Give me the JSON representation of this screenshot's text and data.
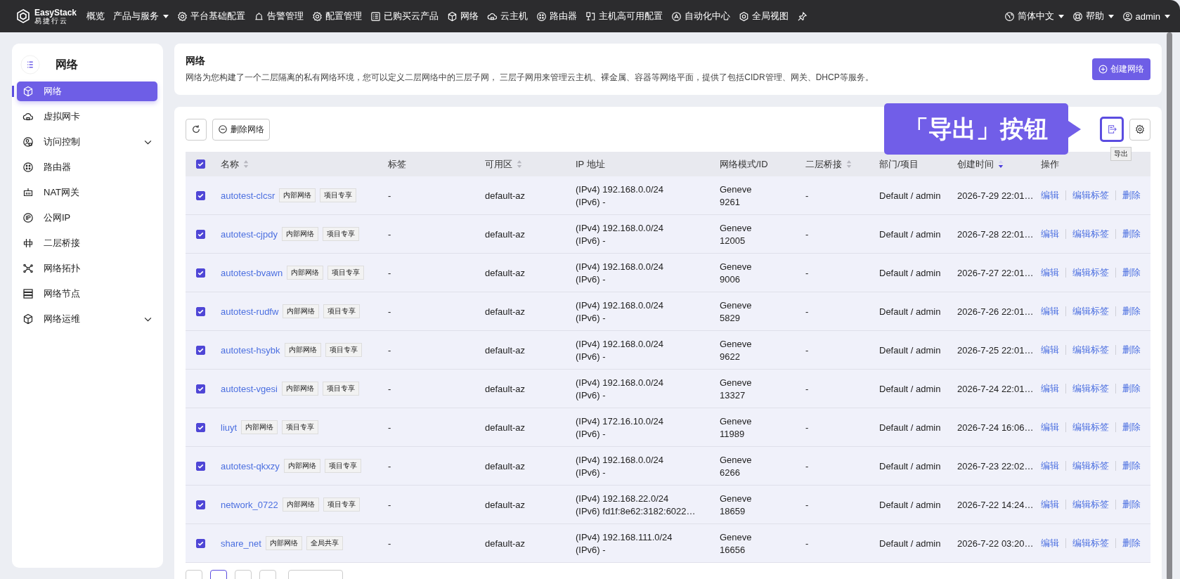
{
  "topnav": {
    "logo": {
      "name": "EasyStack",
      "sub": "易捷行云"
    },
    "items": [
      {
        "label": "概览",
        "dropdown": false
      },
      {
        "label": "产品与服务",
        "dropdown": true
      },
      {
        "label": "平台基础配置",
        "dropdown": false
      },
      {
        "label": "告警管理",
        "dropdown": false
      },
      {
        "label": "配置管理",
        "dropdown": false
      },
      {
        "label": "已购买云产品",
        "dropdown": false
      },
      {
        "label": "网络",
        "dropdown": false
      },
      {
        "label": "云主机",
        "dropdown": false
      },
      {
        "label": "路由器",
        "dropdown": false
      },
      {
        "label": "主机高可用配置",
        "dropdown": false
      },
      {
        "label": "自动化中心",
        "dropdown": false
      },
      {
        "label": "全局视图",
        "dropdown": false
      }
    ],
    "right": [
      {
        "label": "简体中文",
        "dropdown": true
      },
      {
        "label": "帮助",
        "dropdown": true
      },
      {
        "label": "admin",
        "dropdown": true
      }
    ]
  },
  "sidebar": {
    "title": "网络",
    "items": [
      {
        "label": "网络",
        "selected": true,
        "expandable": false
      },
      {
        "label": "虚拟网卡",
        "selected": false,
        "expandable": false
      },
      {
        "label": "访问控制",
        "selected": false,
        "expandable": true
      },
      {
        "label": "路由器",
        "selected": false,
        "expandable": false
      },
      {
        "label": "NAT网关",
        "selected": false,
        "expandable": false
      },
      {
        "label": "公网IP",
        "selected": false,
        "expandable": false
      },
      {
        "label": "二层桥接",
        "selected": false,
        "expandable": false
      },
      {
        "label": "网络拓扑",
        "selected": false,
        "expandable": false
      },
      {
        "label": "网络节点",
        "selected": false,
        "expandable": false
      },
      {
        "label": "网络运维",
        "selected": false,
        "expandable": true
      }
    ]
  },
  "header": {
    "title": "网络",
    "description": "网络为您构建了一个二层隔离的私有网络环境，您可以定义二层网络中的三层子网， 三层子网用来管理云主机、裸金属、容器等网络平面，提供了包括CIDR管理、网关、DHCP等服务。",
    "create_button": "创建网络"
  },
  "toolbar": {
    "delete_button": "删除网络",
    "callout": "「导出」按钮",
    "export_highlighted": true,
    "export_tooltip": "导出"
  },
  "table": {
    "all_checked": true,
    "columns": [
      {
        "label": "名称",
        "sortable": true
      },
      {
        "label": "标签",
        "sortable": false
      },
      {
        "label": "可用区",
        "sortable": true
      },
      {
        "label": "IP 地址",
        "sortable": false
      },
      {
        "label": "网络模式/ID",
        "sortable": false
      },
      {
        "label": "二层桥接",
        "sortable": true
      },
      {
        "label": "部门/项目",
        "sortable": false
      },
      {
        "label": "创建时间",
        "sortable": true,
        "sorted": true
      },
      {
        "label": "操作",
        "sortable": false
      }
    ],
    "rows": [
      {
        "checked": true,
        "name": "autotest-clcsr",
        "tags": [
          "内部网络",
          "项目专享"
        ],
        "labels": "-",
        "az": "default-az",
        "ipv4": "(IPv4) 192.168.0.0/24",
        "ipv6": "(IPv6) -",
        "mode": "Geneve",
        "mode_id": "9261",
        "bridge": "-",
        "project": "Default / admin",
        "created": "2026-7-29 22:01…",
        "actions": [
          "编辑",
          "编辑标签",
          "删除"
        ]
      },
      {
        "checked": true,
        "name": "autotest-cjpdy",
        "tags": [
          "内部网络",
          "项目专享"
        ],
        "labels": "-",
        "az": "default-az",
        "ipv4": "(IPv4) 192.168.0.0/24",
        "ipv6": "(IPv6) -",
        "mode": "Geneve",
        "mode_id": "12005",
        "bridge": "-",
        "project": "Default / admin",
        "created": "2026-7-28 22:01…",
        "actions": [
          "编辑",
          "编辑标签",
          "删除"
        ]
      },
      {
        "checked": true,
        "name": "autotest-bvawn",
        "tags": [
          "内部网络",
          "项目专享"
        ],
        "labels": "-",
        "az": "default-az",
        "ipv4": "(IPv4) 192.168.0.0/24",
        "ipv6": "(IPv6) -",
        "mode": "Geneve",
        "mode_id": "9006",
        "bridge": "-",
        "project": "Default / admin",
        "created": "2026-7-27 22:01…",
        "actions": [
          "编辑",
          "编辑标签",
          "删除"
        ]
      },
      {
        "checked": true,
        "name": "autotest-rudfw",
        "tags": [
          "内部网络",
          "项目专享"
        ],
        "labels": "-",
        "az": "default-az",
        "ipv4": "(IPv4) 192.168.0.0/24",
        "ipv6": "(IPv6) -",
        "mode": "Geneve",
        "mode_id": "5829",
        "bridge": "-",
        "project": "Default / admin",
        "created": "2026-7-26 22:01…",
        "actions": [
          "编辑",
          "编辑标签",
          "删除"
        ]
      },
      {
        "checked": true,
        "name": "autotest-hsybk",
        "tags": [
          "内部网络",
          "项目专享"
        ],
        "labels": "-",
        "az": "default-az",
        "ipv4": "(IPv4) 192.168.0.0/24",
        "ipv6": "(IPv6) -",
        "mode": "Geneve",
        "mode_id": "9622",
        "bridge": "-",
        "project": "Default / admin",
        "created": "2026-7-25 22:01…",
        "actions": [
          "编辑",
          "编辑标签",
          "删除"
        ]
      },
      {
        "checked": true,
        "name": "autotest-vgesi",
        "tags": [
          "内部网络",
          "项目专享"
        ],
        "labels": "-",
        "az": "default-az",
        "ipv4": "(IPv4) 192.168.0.0/24",
        "ipv6": "(IPv6) -",
        "mode": "Geneve",
        "mode_id": "13327",
        "bridge": "-",
        "project": "Default / admin",
        "created": "2026-7-24 22:01…",
        "actions": [
          "编辑",
          "编辑标签",
          "删除"
        ]
      },
      {
        "checked": true,
        "name": "liuyt",
        "tags": [
          "内部网络",
          "项目专享"
        ],
        "labels": "-",
        "az": "default-az",
        "ipv4": "(IPv4) 172.16.10.0/24",
        "ipv6": "(IPv6) -",
        "mode": "Geneve",
        "mode_id": "11989",
        "bridge": "-",
        "project": "Default / admin",
        "created": "2026-7-24 16:06…",
        "actions": [
          "编辑",
          "编辑标签",
          "删除"
        ]
      },
      {
        "checked": true,
        "name": "autotest-qkxzy",
        "tags": [
          "内部网络",
          "项目专享"
        ],
        "labels": "-",
        "az": "default-az",
        "ipv4": "(IPv4) 192.168.0.0/24",
        "ipv6": "(IPv6) -",
        "mode": "Geneve",
        "mode_id": "6266",
        "bridge": "-",
        "project": "Default / admin",
        "created": "2026-7-23 22:02…",
        "actions": [
          "编辑",
          "编辑标签",
          "删除"
        ]
      },
      {
        "checked": true,
        "name": "network_0722",
        "tags": [
          "内部网络",
          "项目专享"
        ],
        "labels": "-",
        "az": "default-az",
        "ipv4": "(IPv4) 192.168.22.0/24",
        "ipv6": "(IPv6) fd1f:8e62:3182:6022…",
        "mode": "Geneve",
        "mode_id": "18659",
        "bridge": "-",
        "project": "Default / admin",
        "created": "2026-7-22 14:24…",
        "actions": [
          "编辑",
          "编辑标签",
          "删除"
        ]
      },
      {
        "checked": true,
        "name": "share_net",
        "tags": [
          "内部网络",
          "全局共享"
        ],
        "labels": "-",
        "az": "default-az",
        "ipv4": "(IPv4) 192.168.111.0/24",
        "ipv6": "(IPv6) -",
        "mode": "Geneve",
        "mode_id": "16656",
        "bridge": "-",
        "project": "Default / admin",
        "created": "2026-7-22 03:20…",
        "actions": [
          "编辑",
          "编辑标签",
          "删除"
        ]
      }
    ]
  }
}
